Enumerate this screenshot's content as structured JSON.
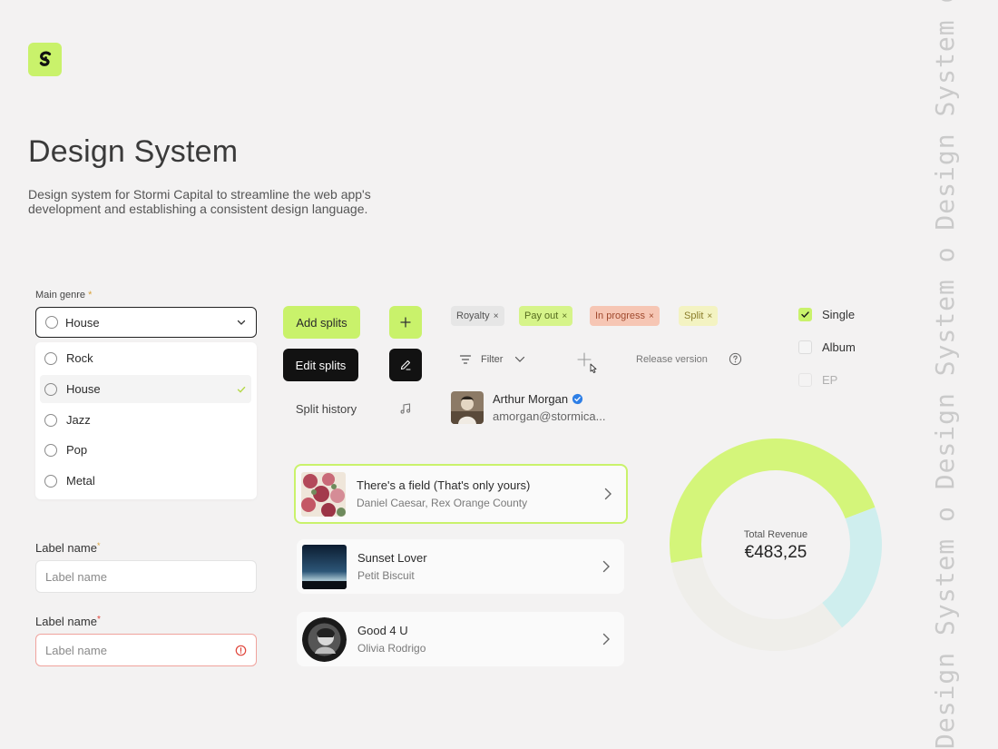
{
  "header": {
    "title": "Design System",
    "description": "Design system for Stormi Capital to streamline the web app's development and establishing a consistent design language."
  },
  "watermark": "Design System o Design System o Design System o Design Syste",
  "genre": {
    "label": "Main genre",
    "required_mark": "*",
    "selected": "House",
    "options": [
      "Rock",
      "House",
      "Jazz",
      "Pop",
      "Metal"
    ],
    "checked_option": "House"
  },
  "label_field_1": {
    "label": "Label name",
    "required_mark": "*",
    "placeholder": "Label name"
  },
  "label_field_2": {
    "label": "Label name",
    "required_mark": "*",
    "placeholder": "Label name",
    "state": "error"
  },
  "buttons": {
    "add_splits": "Add splits",
    "edit_splits": "Edit splits",
    "split_history": "Split history",
    "plus_icon": "plus-icon",
    "pen_icon": "pen-icon",
    "music_icon": "music-note-icon"
  },
  "chips": [
    {
      "label": "Royalty",
      "bg": "#e6e6e6"
    },
    {
      "label": "Pay out",
      "bg": "#d6f48a"
    },
    {
      "label": "In progress",
      "bg": "#f6c6b4"
    },
    {
      "label": "Split",
      "bg": "#f3f3c2"
    }
  ],
  "chip_close": "×",
  "filter": {
    "label": "Filter",
    "release_version": "Release version"
  },
  "user": {
    "name": "Arthur Morgan",
    "email": "amorgan@stormica..."
  },
  "release_types": [
    {
      "label": "Single",
      "checked": true
    },
    {
      "label": "Album",
      "checked": false
    },
    {
      "label": "EP",
      "checked": false
    }
  ],
  "songs": [
    {
      "title": "There's a field (That's only yours)",
      "artist": "Daniel Caesar, Rex Orange County"
    },
    {
      "title": "Sunset Lover",
      "artist": "Petit Biscuit"
    },
    {
      "title": "Good 4 U",
      "artist": "Olivia Rodrigo"
    }
  ],
  "revenue": {
    "label": "Total Revenue",
    "value": "€483,25"
  },
  "chart_data": {
    "type": "pie",
    "title": "Total Revenue",
    "series": [
      {
        "value": 0.47,
        "color": "#d4f57a"
      },
      {
        "value": 0.2,
        "color": "#cfeeee"
      },
      {
        "value": 0.33,
        "color": "#efeeea"
      }
    ]
  },
  "colors": {
    "accent": "#c9f26b",
    "dark": "#121212",
    "background": "#f3f2f2"
  }
}
